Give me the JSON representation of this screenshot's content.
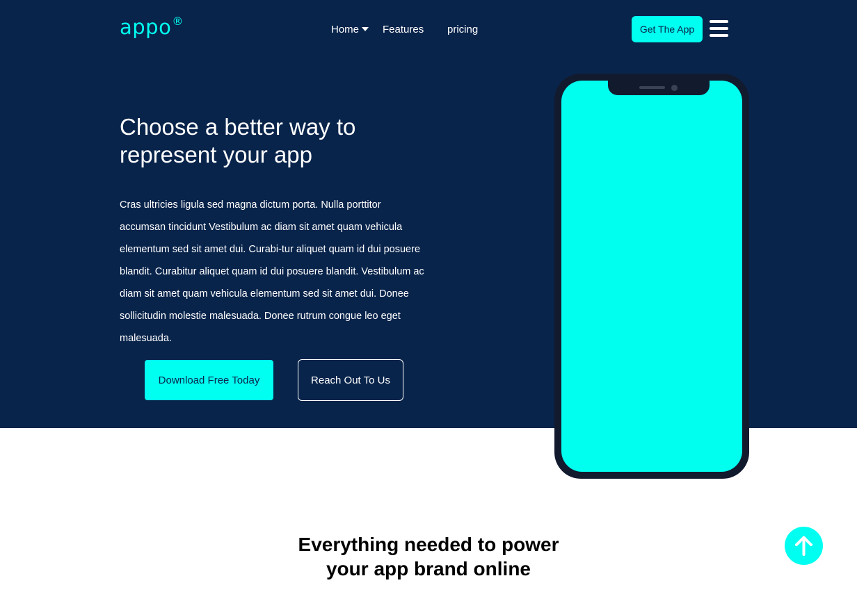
{
  "header": {
    "logo_text": "appo",
    "logo_mark": "®",
    "nav": {
      "home": "Home",
      "features": "Features",
      "pricing": "pricing"
    },
    "cta_label": "Get The App",
    "menu_icon": "hamburger-menu-icon"
  },
  "hero": {
    "title": "Choose a better way to represent your app",
    "body": "Cras ultricies ligula sed magna dictum porta. Nulla porttitor accumsan tincidunt Vestibulum ac diam sit amet quam vehicula elementum sed sit amet dui. Curabi-tur aliquet quam id dui posuere blandit. Curabitur aliquet quam id dui posuere blandit. Vestibulum ac diam sit amet quam vehicula elementum sed sit amet dui. Donee sollicitudin molestie malesuada. Donee rutrum congue leo eget malesuada.",
    "primary_button": "Download Free Today",
    "secondary_button": "Reach Out To Us"
  },
  "features_section": {
    "title": "Everything needed to power your app brand online"
  },
  "scroll_top_icon": "arrow-up-icon",
  "colors": {
    "navy": "#09244b",
    "accent": "#00fff0",
    "phone_frame": "#121a2e"
  }
}
